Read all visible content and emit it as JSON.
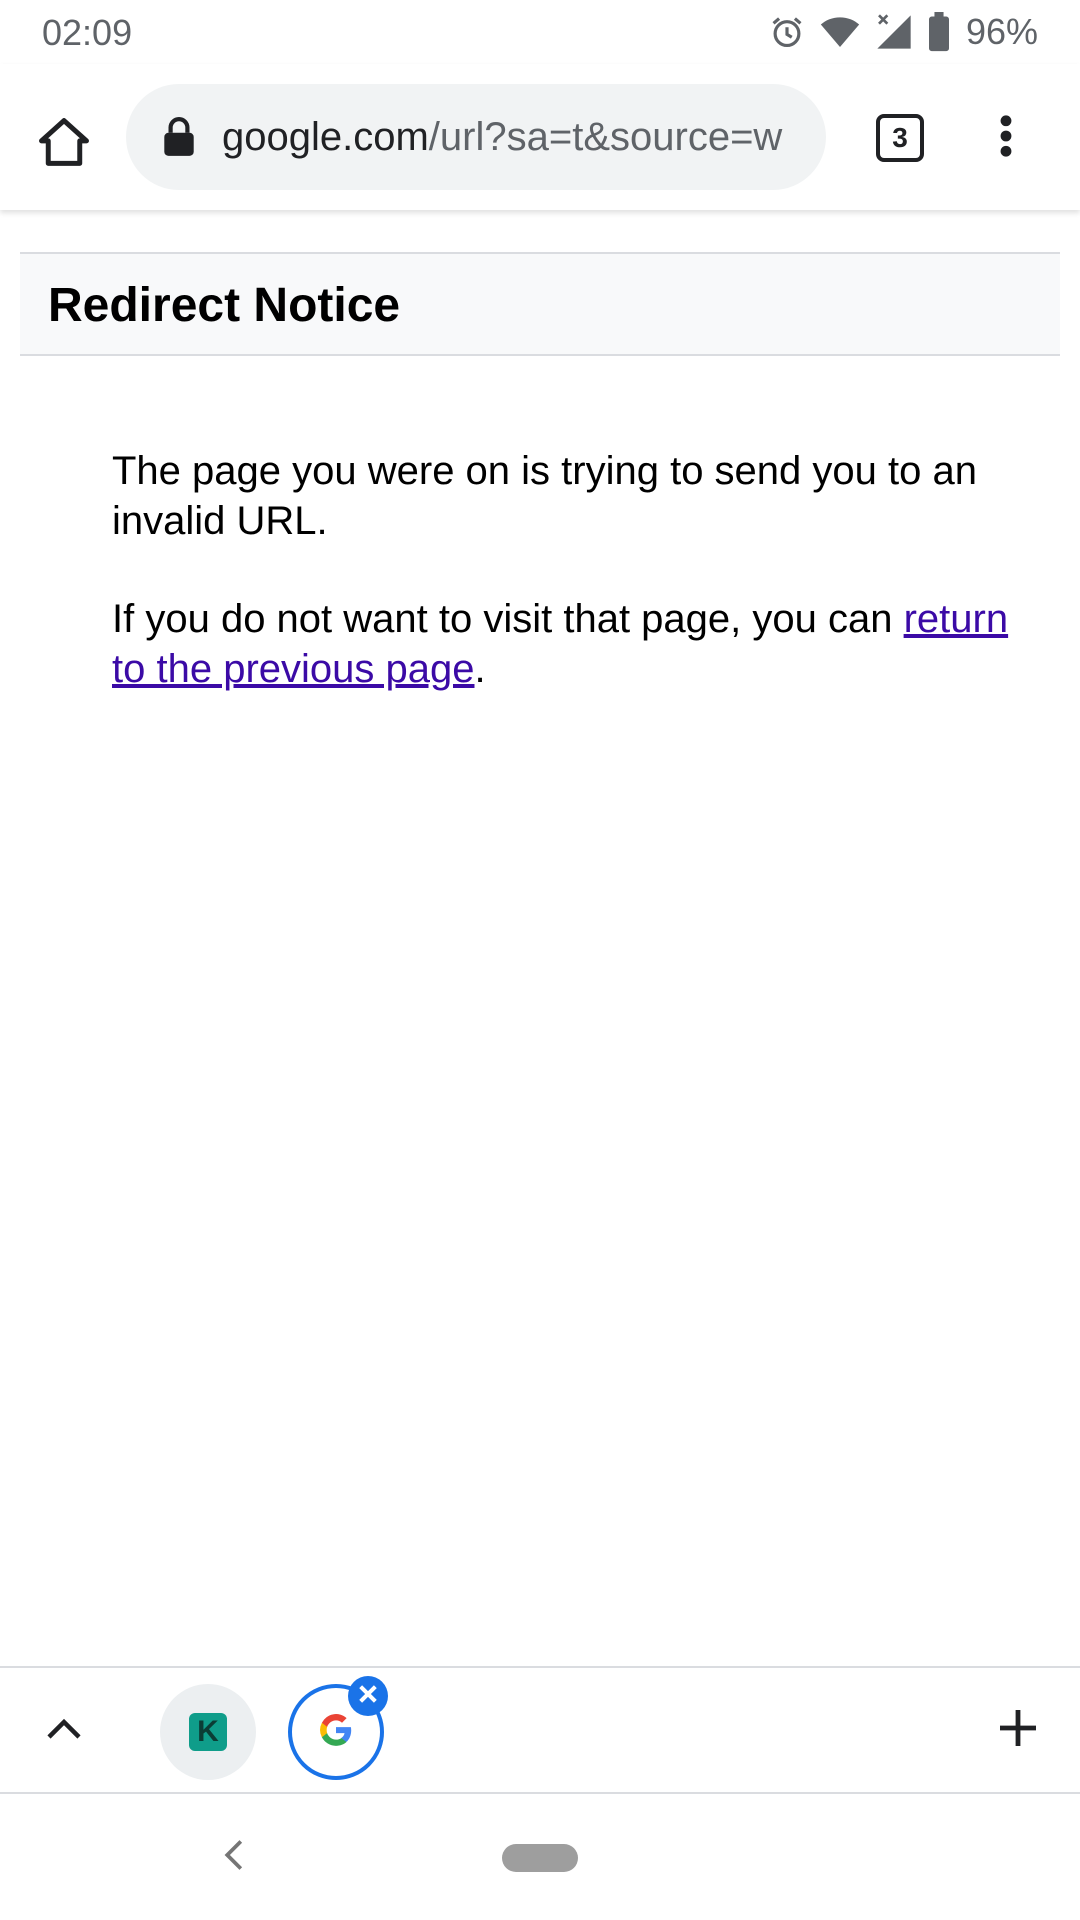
{
  "status_bar": {
    "time": "02:09",
    "battery_percent": "96%",
    "icons": [
      "alarm-icon",
      "wifi-icon",
      "signal-icon",
      "battery-icon"
    ]
  },
  "toolbar": {
    "url_domain": "google.com",
    "url_path": "/url?sa=t&source=w",
    "tab_count": "3",
    "icons": [
      "home-icon",
      "lock-icon",
      "more-vert-icon"
    ]
  },
  "page": {
    "title": "Redirect Notice",
    "paragraph1": " The page you were on is trying to send you to an invalid URL.",
    "paragraph2_prefix": " If you do not want to visit that page, you can ",
    "paragraph2_link": "return to the previous page",
    "paragraph2_suffix": "."
  },
  "tab_strip": {
    "tabs": [
      {
        "favicon_letter": "K",
        "active": false
      },
      {
        "favicon_letter": "G",
        "active": true
      }
    ],
    "icons": [
      "chevron-up-icon",
      "close-icon",
      "plus-icon"
    ]
  },
  "colors": {
    "accent": "#1a73e8",
    "link": "#3b0aa6",
    "omnibox_bg": "#f1f3f4",
    "header_bg": "#f8f9fa"
  }
}
